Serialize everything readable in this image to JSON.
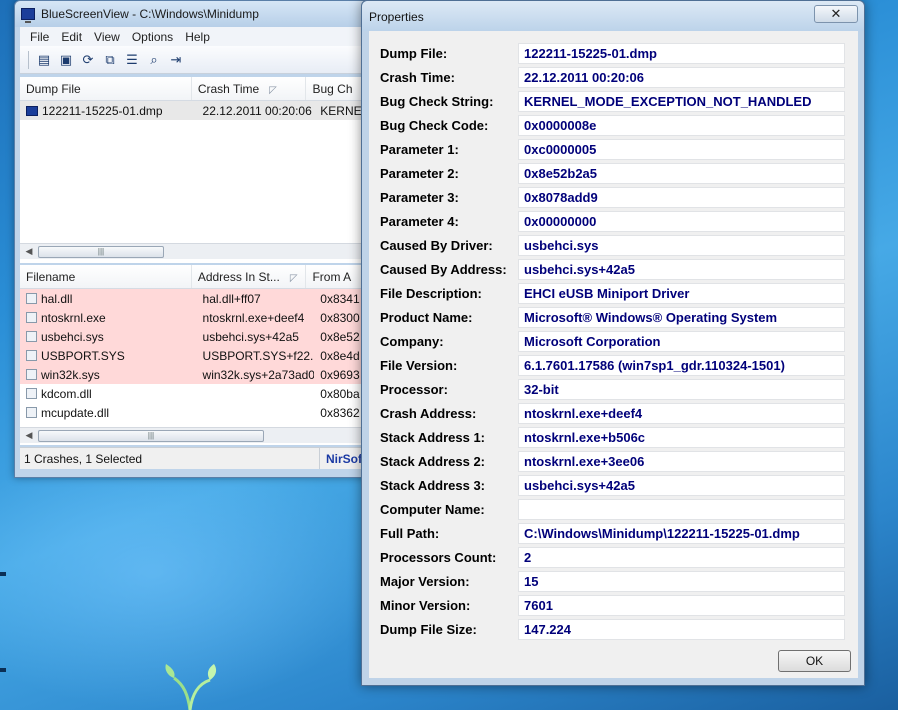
{
  "main_window": {
    "title": "BlueScreenView  -  C:\\Windows\\Minidump",
    "menu": [
      "File",
      "Edit",
      "View",
      "Options",
      "Help"
    ],
    "toolbar_icons": [
      "html-report-icon",
      "save-icon",
      "refresh-icon",
      "copy-icon",
      "properties-icon",
      "find-icon",
      "exit-icon"
    ],
    "top_columns": [
      "Dump File",
      "Crash Time",
      "Bug Ch"
    ],
    "crashes": [
      {
        "dump_file": "122211-15225-01.dmp",
        "crash_time": "22.12.2011 00:20:06",
        "bug": "KERNE"
      }
    ],
    "bottom_columns": [
      "Filename",
      "Address In St...",
      "From A"
    ],
    "modules": [
      {
        "filename": "hal.dll",
        "address": "hal.dll+ff07",
        "from": "0x8341",
        "highlight": true
      },
      {
        "filename": "ntoskrnl.exe",
        "address": "ntoskrnl.exe+deef4",
        "from": "0x8300",
        "highlight": true
      },
      {
        "filename": "usbehci.sys",
        "address": "usbehci.sys+42a5",
        "from": "0x8e52",
        "highlight": true
      },
      {
        "filename": "USBPORT.SYS",
        "address": "USBPORT.SYS+f22...",
        "from": "0x8e4d",
        "highlight": true
      },
      {
        "filename": "win32k.sys",
        "address": "win32k.sys+2a73ad0",
        "from": "0x9693",
        "highlight": true
      },
      {
        "filename": "kdcom.dll",
        "address": "",
        "from": "0x80ba",
        "highlight": false
      },
      {
        "filename": "mcupdate.dll",
        "address": "",
        "from": "0x8362",
        "highlight": false
      }
    ],
    "status": "1 Crashes, 1 Selected",
    "status_link": "NirSof"
  },
  "dialog": {
    "title": "Properties",
    "close": "✕",
    "ok": "OK",
    "properties": [
      {
        "label": "Dump File:",
        "value": "122211-15225-01.dmp"
      },
      {
        "label": "Crash Time:",
        "value": "22.12.2011 00:20:06"
      },
      {
        "label": "Bug Check String:",
        "value": "KERNEL_MODE_EXCEPTION_NOT_HANDLED"
      },
      {
        "label": "Bug Check Code:",
        "value": "0x0000008e"
      },
      {
        "label": "Parameter 1:",
        "value": "0xc0000005"
      },
      {
        "label": "Parameter 2:",
        "value": "0x8e52b2a5"
      },
      {
        "label": "Parameter 3:",
        "value": "0x8078add9"
      },
      {
        "label": "Parameter 4:",
        "value": "0x00000000"
      },
      {
        "label": "Caused By Driver:",
        "value": "usbehci.sys"
      },
      {
        "label": "Caused By Address:",
        "value": "usbehci.sys+42a5"
      },
      {
        "label": "File Description:",
        "value": "EHCI eUSB Miniport Driver"
      },
      {
        "label": "Product Name:",
        "value": "Microsoft® Windows® Operating System"
      },
      {
        "label": "Company:",
        "value": "Microsoft Corporation"
      },
      {
        "label": "File Version:",
        "value": "6.1.7601.17586 (win7sp1_gdr.110324-1501)"
      },
      {
        "label": "Processor:",
        "value": "32-bit"
      },
      {
        "label": "Crash Address:",
        "value": "ntoskrnl.exe+deef4"
      },
      {
        "label": "Stack Address 1:",
        "value": "ntoskrnl.exe+b506c"
      },
      {
        "label": "Stack Address 2:",
        "value": "ntoskrnl.exe+3ee06"
      },
      {
        "label": "Stack Address 3:",
        "value": "usbehci.sys+42a5"
      },
      {
        "label": "Computer Name:",
        "value": ""
      },
      {
        "label": "Full Path:",
        "value": "C:\\Windows\\Minidump\\122211-15225-01.dmp"
      },
      {
        "label": "Processors Count:",
        "value": "2"
      },
      {
        "label": "Major Version:",
        "value": "15"
      },
      {
        "label": "Minor Version:",
        "value": "7601"
      },
      {
        "label": "Dump File Size:",
        "value": "147.224"
      }
    ]
  }
}
